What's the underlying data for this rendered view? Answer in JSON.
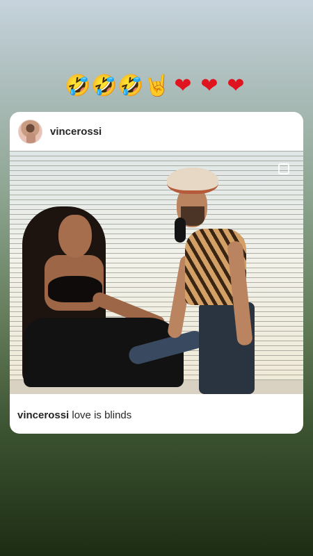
{
  "stickers": {
    "items": [
      {
        "glyph": "🤣",
        "icon": "rolling-laughing-icon"
      },
      {
        "glyph": "🤣",
        "icon": "rolling-laughing-icon"
      },
      {
        "glyph": "🤣",
        "icon": "rolling-laughing-icon"
      },
      {
        "glyph": "🤘",
        "icon": "rock-on-hand-icon"
      },
      {
        "glyph": "❤",
        "icon": "red-heart-icon"
      },
      {
        "glyph": "❤",
        "icon": "red-heart-icon"
      },
      {
        "glyph": "❤",
        "icon": "red-heart-icon"
      }
    ]
  },
  "post": {
    "username": "vincerossi",
    "caption_username": "vincerossi",
    "caption_text": " love is blinds"
  },
  "colors": {
    "card_bg": "#ffffff",
    "text": "#262626",
    "heart": "#e0141e",
    "laugh": "#f2b01e"
  }
}
